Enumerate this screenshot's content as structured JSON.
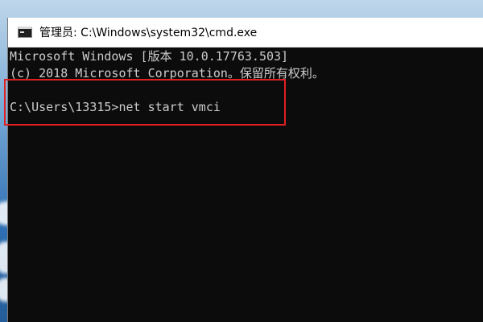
{
  "window": {
    "title": "管理员: C:\\Windows\\system32\\cmd.exe",
    "icon": "cmd-console-icon"
  },
  "console": {
    "lines": [
      "Microsoft Windows [版本 10.0.17763.503]",
      "(c) 2018 Microsoft Corporation。保留所有权利。",
      ""
    ],
    "prompt": "C:\\Users\\13315>",
    "command": "net start vmci"
  },
  "colors": {
    "console_background": "#0c0c0c",
    "console_text": "#cccccc",
    "highlight": "#e02020",
    "titlebar": "#ffffff"
  }
}
